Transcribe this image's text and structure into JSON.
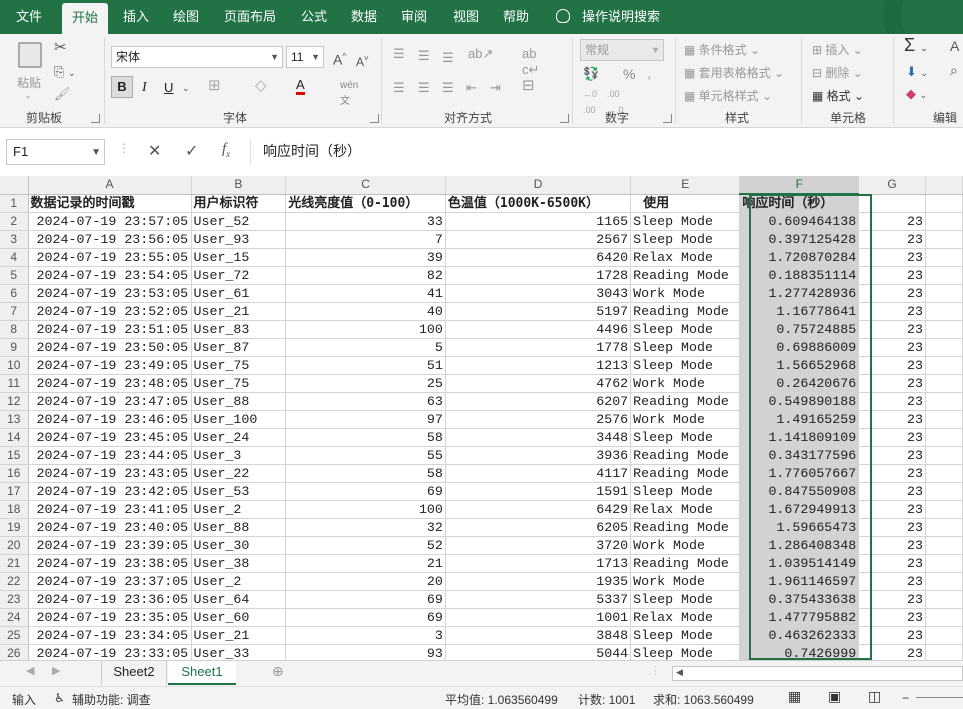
{
  "menu_tabs": [
    "文件",
    "开始",
    "插入",
    "绘图",
    "页面布局",
    "公式",
    "数据",
    "审阅",
    "视图",
    "帮助"
  ],
  "tell_me": "操作说明搜索",
  "ribbon": {
    "clipboard": {
      "label": "剪贴板",
      "paste": "粘贴"
    },
    "font": {
      "label": "字体",
      "font_name": "宋体",
      "font_size": "11",
      "bold": "B",
      "italic": "I",
      "underline": "U"
    },
    "alignment": {
      "label": "对齐方式"
    },
    "number": {
      "label": "数字",
      "format": "常规"
    },
    "styles": {
      "label": "样式",
      "conditional": "条件格式",
      "table_format": "套用表格格式",
      "cell_styles": "单元格样式"
    },
    "cells": {
      "label": "单元格",
      "insert": "插入",
      "delete": "删除",
      "format": "格式"
    },
    "editing": {
      "label": "编辑"
    }
  },
  "formula_bar": {
    "name_box": "F1",
    "formula": "响应时间（秒）"
  },
  "columns": [
    "A",
    "B",
    "C",
    "D",
    "E",
    "F",
    "G"
  ],
  "selected_column": "F",
  "headers": [
    "数据记录的时间戳",
    "用户标识符",
    "光线亮度值（0-100）",
    "色温值（1000K-6500K）",
    "使用",
    "响应时间（秒）",
    ""
  ],
  "rows": [
    [
      "2024-07-19 23:57:05",
      "User_52",
      "33",
      "1165",
      "Sleep Mode",
      "0.609464138",
      "23"
    ],
    [
      "2024-07-19 23:56:05",
      "User_93",
      "7",
      "2567",
      "Sleep Mode",
      "0.397125428",
      "23"
    ],
    [
      "2024-07-19 23:55:05",
      "User_15",
      "39",
      "6420",
      "Relax Mode",
      "1.720870284",
      "23"
    ],
    [
      "2024-07-19 23:54:05",
      "User_72",
      "82",
      "1728",
      "Reading Mode",
      "0.188351114",
      "23"
    ],
    [
      "2024-07-19 23:53:05",
      "User_61",
      "41",
      "3043",
      "Work Mode",
      "1.277428936",
      "23"
    ],
    [
      "2024-07-19 23:52:05",
      "User_21",
      "40",
      "5197",
      "Reading Mode",
      "1.16778641",
      "23"
    ],
    [
      "2024-07-19 23:51:05",
      "User_83",
      "100",
      "4496",
      "Sleep Mode",
      "0.75724885",
      "23"
    ],
    [
      "2024-07-19 23:50:05",
      "User_87",
      "5",
      "1778",
      "Sleep Mode",
      "0.69886009",
      "23"
    ],
    [
      "2024-07-19 23:49:05",
      "User_75",
      "51",
      "1213",
      "Sleep Mode",
      "1.56652968",
      "23"
    ],
    [
      "2024-07-19 23:48:05",
      "User_75",
      "25",
      "4762",
      "Work Mode",
      "0.26420676",
      "23"
    ],
    [
      "2024-07-19 23:47:05",
      "User_88",
      "63",
      "6207",
      "Reading Mode",
      "0.549890188",
      "23"
    ],
    [
      "2024-07-19 23:46:05",
      "User_100",
      "97",
      "2576",
      "Work Mode",
      "1.49165259",
      "23"
    ],
    [
      "2024-07-19 23:45:05",
      "User_24",
      "58",
      "3448",
      "Sleep Mode",
      "1.141809109",
      "23"
    ],
    [
      "2024-07-19 23:44:05",
      "User_3",
      "55",
      "3936",
      "Reading Mode",
      "0.343177596",
      "23"
    ],
    [
      "2024-07-19 23:43:05",
      "User_22",
      "58",
      "4117",
      "Reading Mode",
      "1.776057667",
      "23"
    ],
    [
      "2024-07-19 23:42:05",
      "User_53",
      "69",
      "1591",
      "Sleep Mode",
      "0.847550908",
      "23"
    ],
    [
      "2024-07-19 23:41:05",
      "User_2",
      "100",
      "6429",
      "Relax Mode",
      "1.672949913",
      "23"
    ],
    [
      "2024-07-19 23:40:05",
      "User_88",
      "32",
      "6205",
      "Reading Mode",
      "1.59665473",
      "23"
    ],
    [
      "2024-07-19 23:39:05",
      "User_30",
      "52",
      "3720",
      "Work Mode",
      "1.286408348",
      "23"
    ],
    [
      "2024-07-19 23:38:05",
      "User_38",
      "21",
      "1713",
      "Reading Mode",
      "1.039514149",
      "23"
    ],
    [
      "2024-07-19 23:37:05",
      "User_2",
      "20",
      "1935",
      "Work Mode",
      "1.961146597",
      "23"
    ],
    [
      "2024-07-19 23:36:05",
      "User_64",
      "69",
      "5337",
      "Sleep Mode",
      "0.375433638",
      "23"
    ],
    [
      "2024-07-19 23:35:05",
      "User_60",
      "69",
      "1001",
      "Relax Mode",
      "1.477795882",
      "23"
    ],
    [
      "2024-07-19 23:34:05",
      "User_21",
      "3",
      "3848",
      "Sleep Mode",
      "0.463262333",
      "23"
    ],
    [
      "2024-07-19 23:33:05",
      "User_33",
      "93",
      "5044",
      "Sleep Mode",
      "0.7426999",
      "23"
    ]
  ],
  "sheets": [
    "Sheet2",
    "Sheet1"
  ],
  "active_sheet": "Sheet1",
  "status": {
    "mode": "输入",
    "accessibility": "辅助功能: 调查",
    "average": "平均值: 1.063560499",
    "count": "计数: 1001",
    "sum": "求和: 1063.560499"
  },
  "colors": {
    "accent": "#217346",
    "selection": "#d2d2d2"
  }
}
